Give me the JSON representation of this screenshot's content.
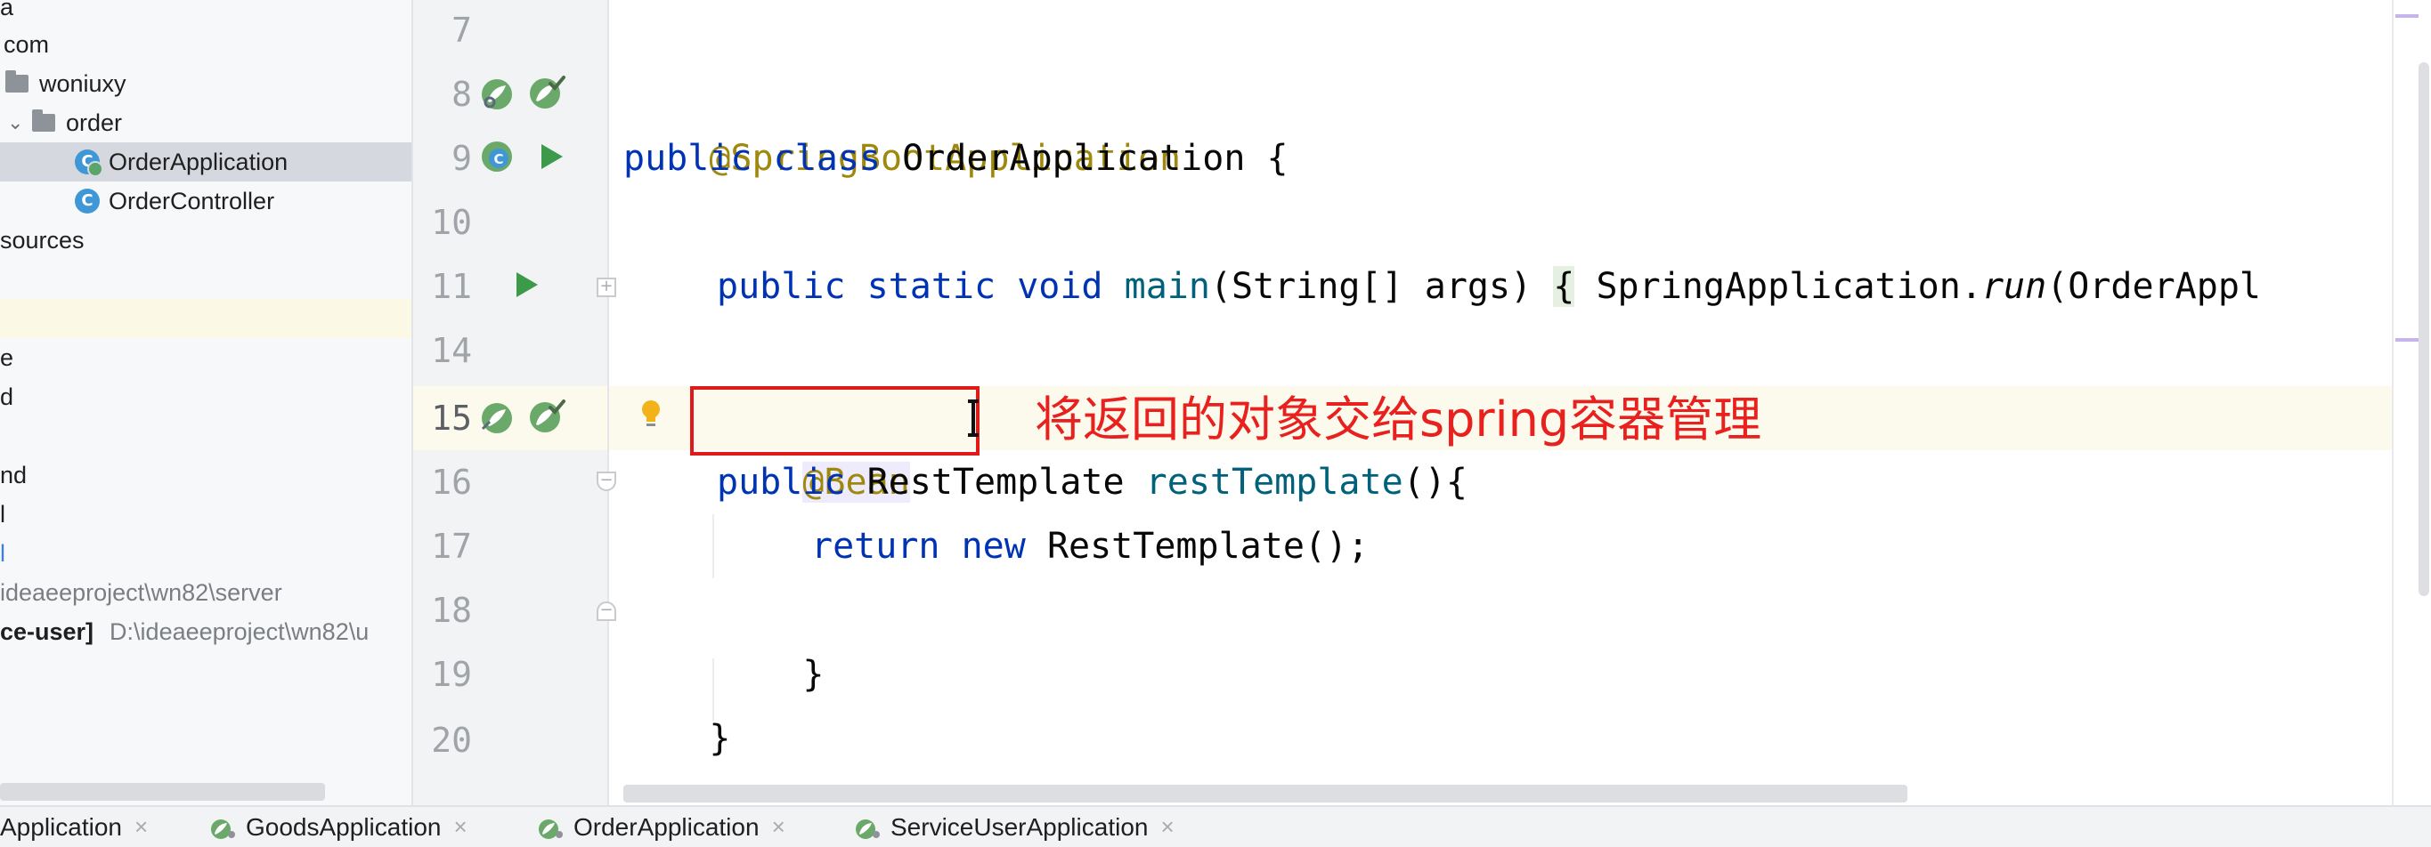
{
  "project_tree": {
    "items": [
      {
        "label": "a"
      },
      {
        "label": "com"
      },
      {
        "label": "woniuxy"
      },
      {
        "label": "order"
      },
      {
        "label": "OrderApplication"
      },
      {
        "label": "OrderController"
      },
      {
        "label": "sources"
      },
      {
        "label": "e"
      },
      {
        "label": "d"
      },
      {
        "label": "nd"
      },
      {
        "label": "l"
      },
      {
        "label": "l"
      },
      {
        "label": "ideaeeproject\\wn82\\server"
      },
      {
        "label": "ce-user]",
        "path": "D:\\ideaeeproject\\wn82\\u"
      },
      {
        "label": "a"
      }
    ]
  },
  "editor": {
    "lines": [
      {
        "num": "7"
      },
      {
        "num": "8",
        "annotation": "@SpringBootApplication"
      },
      {
        "num": "9",
        "kw1": "public",
        "kw2": "class",
        "name": "OrderApplication",
        "brace": "{"
      },
      {
        "num": "10"
      },
      {
        "num": "11",
        "kw1": "public",
        "kw2": "static",
        "kw3": "void",
        "fn": "main",
        "params": "(String[] args)",
        "brace": "{",
        "body_class": "SpringApplication.",
        "body_method": "run",
        "body_args": "(OrderAppl"
      },
      {
        "num": "14"
      },
      {
        "num": "15",
        "annotation": "@Bean"
      },
      {
        "num": "16",
        "kw1": "public",
        "type": "RestTemplate",
        "fn": "restTemplate",
        "rest": "(){"
      },
      {
        "num": "17",
        "kw1": "return",
        "kw2": "new",
        "rest": "RestTemplate();"
      },
      {
        "num": "18",
        "rest": "}"
      },
      {
        "num": "19",
        "rest": "}"
      },
      {
        "num": "20"
      }
    ],
    "overlay_note": "将返回的对象交给spring容器管理"
  },
  "run_tabs": [
    {
      "label": "Application"
    },
    {
      "label": "GoodsApplication"
    },
    {
      "label": "OrderApplication"
    },
    {
      "label": "ServiceUserApplication"
    }
  ],
  "colors": {
    "keyword": "#0033b3",
    "annotation": "#9e880d",
    "method": "#00627a",
    "overlay_red": "#e01919"
  },
  "icons": [
    "folder-icon",
    "class-icon",
    "spring-bean-icon",
    "run-icon",
    "bulb-icon",
    "fold-icon",
    "close-icon",
    "spring-boot-icon"
  ]
}
